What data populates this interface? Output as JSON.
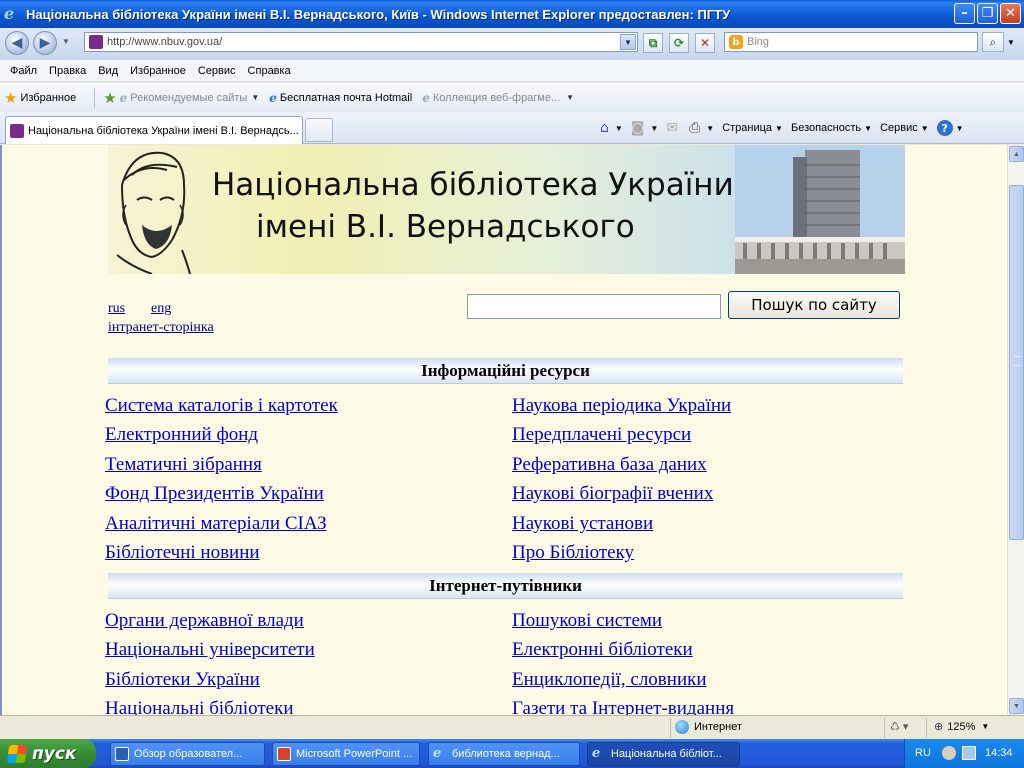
{
  "window": {
    "title": "Національна бібліотека України імені В.І. Вернадського, Київ - Windows Internet Explorer предоставлен: ПГТУ"
  },
  "address": {
    "url": "http://www.nbuv.gov.ua/",
    "search_placeholder": "Bing"
  },
  "menu": [
    "Файл",
    "Правка",
    "Вид",
    "Избранное",
    "Сервис",
    "Справка"
  ],
  "favorites": {
    "label": "Избранное",
    "items": [
      "Рекомендуемые сайты",
      "Бесплатная почта Hotmail",
      "Коллекция веб-фрагме..."
    ]
  },
  "tab": {
    "title": "Національна бібліотека України імені В.І. Вернадсь..."
  },
  "commands": {
    "page": "Страница",
    "security": "Безопасность",
    "tools": "Сервис"
  },
  "banner": {
    "line1": "Національна бібліотека України",
    "line2": "імені В.І. Вернадського"
  },
  "lang_links": {
    "rus": "rus",
    "eng": "eng",
    "intranet": "інтранет-сторінка"
  },
  "site_search": {
    "button": "Пошук по сайту"
  },
  "sections": [
    {
      "title": "Інформаційні ресурси",
      "left": [
        "Система каталогів і картотек",
        "Електронний фонд",
        "Тематичні зібрання",
        "Фонд Президентів України",
        "Аналітичні матеріали СІАЗ",
        "Бібліотечні новини"
      ],
      "right": [
        "Наукова періодика України",
        "Передплачені ресурси",
        "Реферативна база даних",
        "Наукові біографії вчених",
        "Наукові установи",
        "Про Бібліотеку"
      ]
    },
    {
      "title": "Інтернет-путівники",
      "left": [
        "Органи державної влади",
        "Національні університети",
        "Бібліотеки України",
        "Національні бібліотеки"
      ],
      "right": [
        "Пошукові системи",
        "Електронні бібліотеки",
        "Енциклопедії, словники",
        "Газети та Інтернет-видання"
      ]
    }
  ],
  "status": {
    "zone": "Интернет",
    "zoom": "125%"
  },
  "taskbar": {
    "start": "пуск",
    "items": [
      "Обзор образовател...",
      "Microsoft PowerPoint ...",
      "библиотека вернад...",
      "Національна бібліот..."
    ],
    "lang": "RU",
    "clock": "14:34"
  }
}
